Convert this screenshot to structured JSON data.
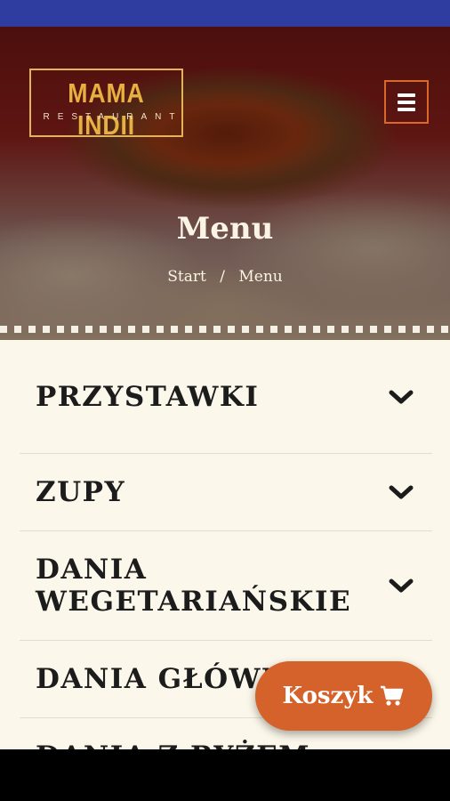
{
  "colors": {
    "status_bar": "#2f3da0",
    "accent": "#d4622a",
    "logo_gold": "#e8b040",
    "background": "#fbf7ea"
  },
  "logo": {
    "title": "MAMA INDII",
    "subtitle": "RESTAURANT"
  },
  "header": {
    "page_title": "Menu",
    "breadcrumb": {
      "start": "Start",
      "separator": "/",
      "current": "Menu"
    }
  },
  "menu": {
    "categories": [
      {
        "label": "PRZYSTAWKI",
        "icon": "chevron-down-icon"
      },
      {
        "label": "ZUPY",
        "icon": "chevron-down-icon"
      },
      {
        "label": "DANIA WEGETARIAŃSKIE",
        "icon": "chevron-down-icon"
      },
      {
        "label": "DANIA GŁÓWNE",
        "icon": "chevron-down-icon"
      },
      {
        "label": "DANIA Z RYŻEM",
        "icon": "chevron-down-icon"
      }
    ]
  },
  "cart_button": {
    "label": "Koszyk",
    "icon": "cart-icon"
  }
}
